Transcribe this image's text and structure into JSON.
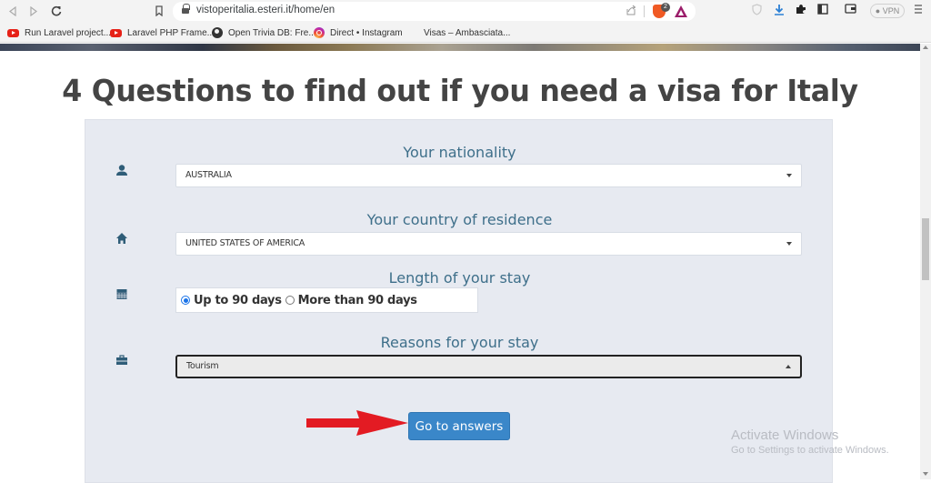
{
  "browser": {
    "url": "vistoperitalia.esteri.it/home/en",
    "brave_badge_count": "2",
    "vpn_label": "VPN",
    "bookmarks": [
      {
        "label": "Run Laravel project...",
        "icon": "youtube-icon"
      },
      {
        "label": "Laravel PHP Frame...",
        "icon": "youtube-icon"
      },
      {
        "label": "Open Trivia DB: Fre...",
        "icon": "globe-icon"
      },
      {
        "label": "Direct • Instagram",
        "icon": "instagram-icon"
      },
      {
        "label": "Visas – Ambasciata...",
        "icon": "blank-icon"
      }
    ]
  },
  "page": {
    "title": "4 Questions to find out if you need a visa for Italy",
    "questions": [
      {
        "label": "Your nationality",
        "icon": "user-icon",
        "type": "select",
        "value": "AUSTRALIA"
      },
      {
        "label": "Your country of residence",
        "icon": "home-icon",
        "type": "select",
        "value": "UNITED STATES OF AMERICA"
      },
      {
        "label": "Length of your stay",
        "icon": "calendar-icon",
        "type": "radio",
        "options": [
          {
            "label": "Up to 90 days",
            "checked": true
          },
          {
            "label": "More than 90 days",
            "checked": false
          }
        ]
      },
      {
        "label": "Reasons for your stay",
        "icon": "briefcase-icon",
        "type": "select",
        "value": "Tourism",
        "state": "open"
      }
    ],
    "submit_label": "Go to answers",
    "annotation_arrow_color": "#e31b23",
    "accent_color": "#3a87c9",
    "label_color": "#3e6f8a"
  },
  "os_overlay": {
    "line1": "Activate Windows",
    "line2": "Go to Settings to activate Windows."
  }
}
